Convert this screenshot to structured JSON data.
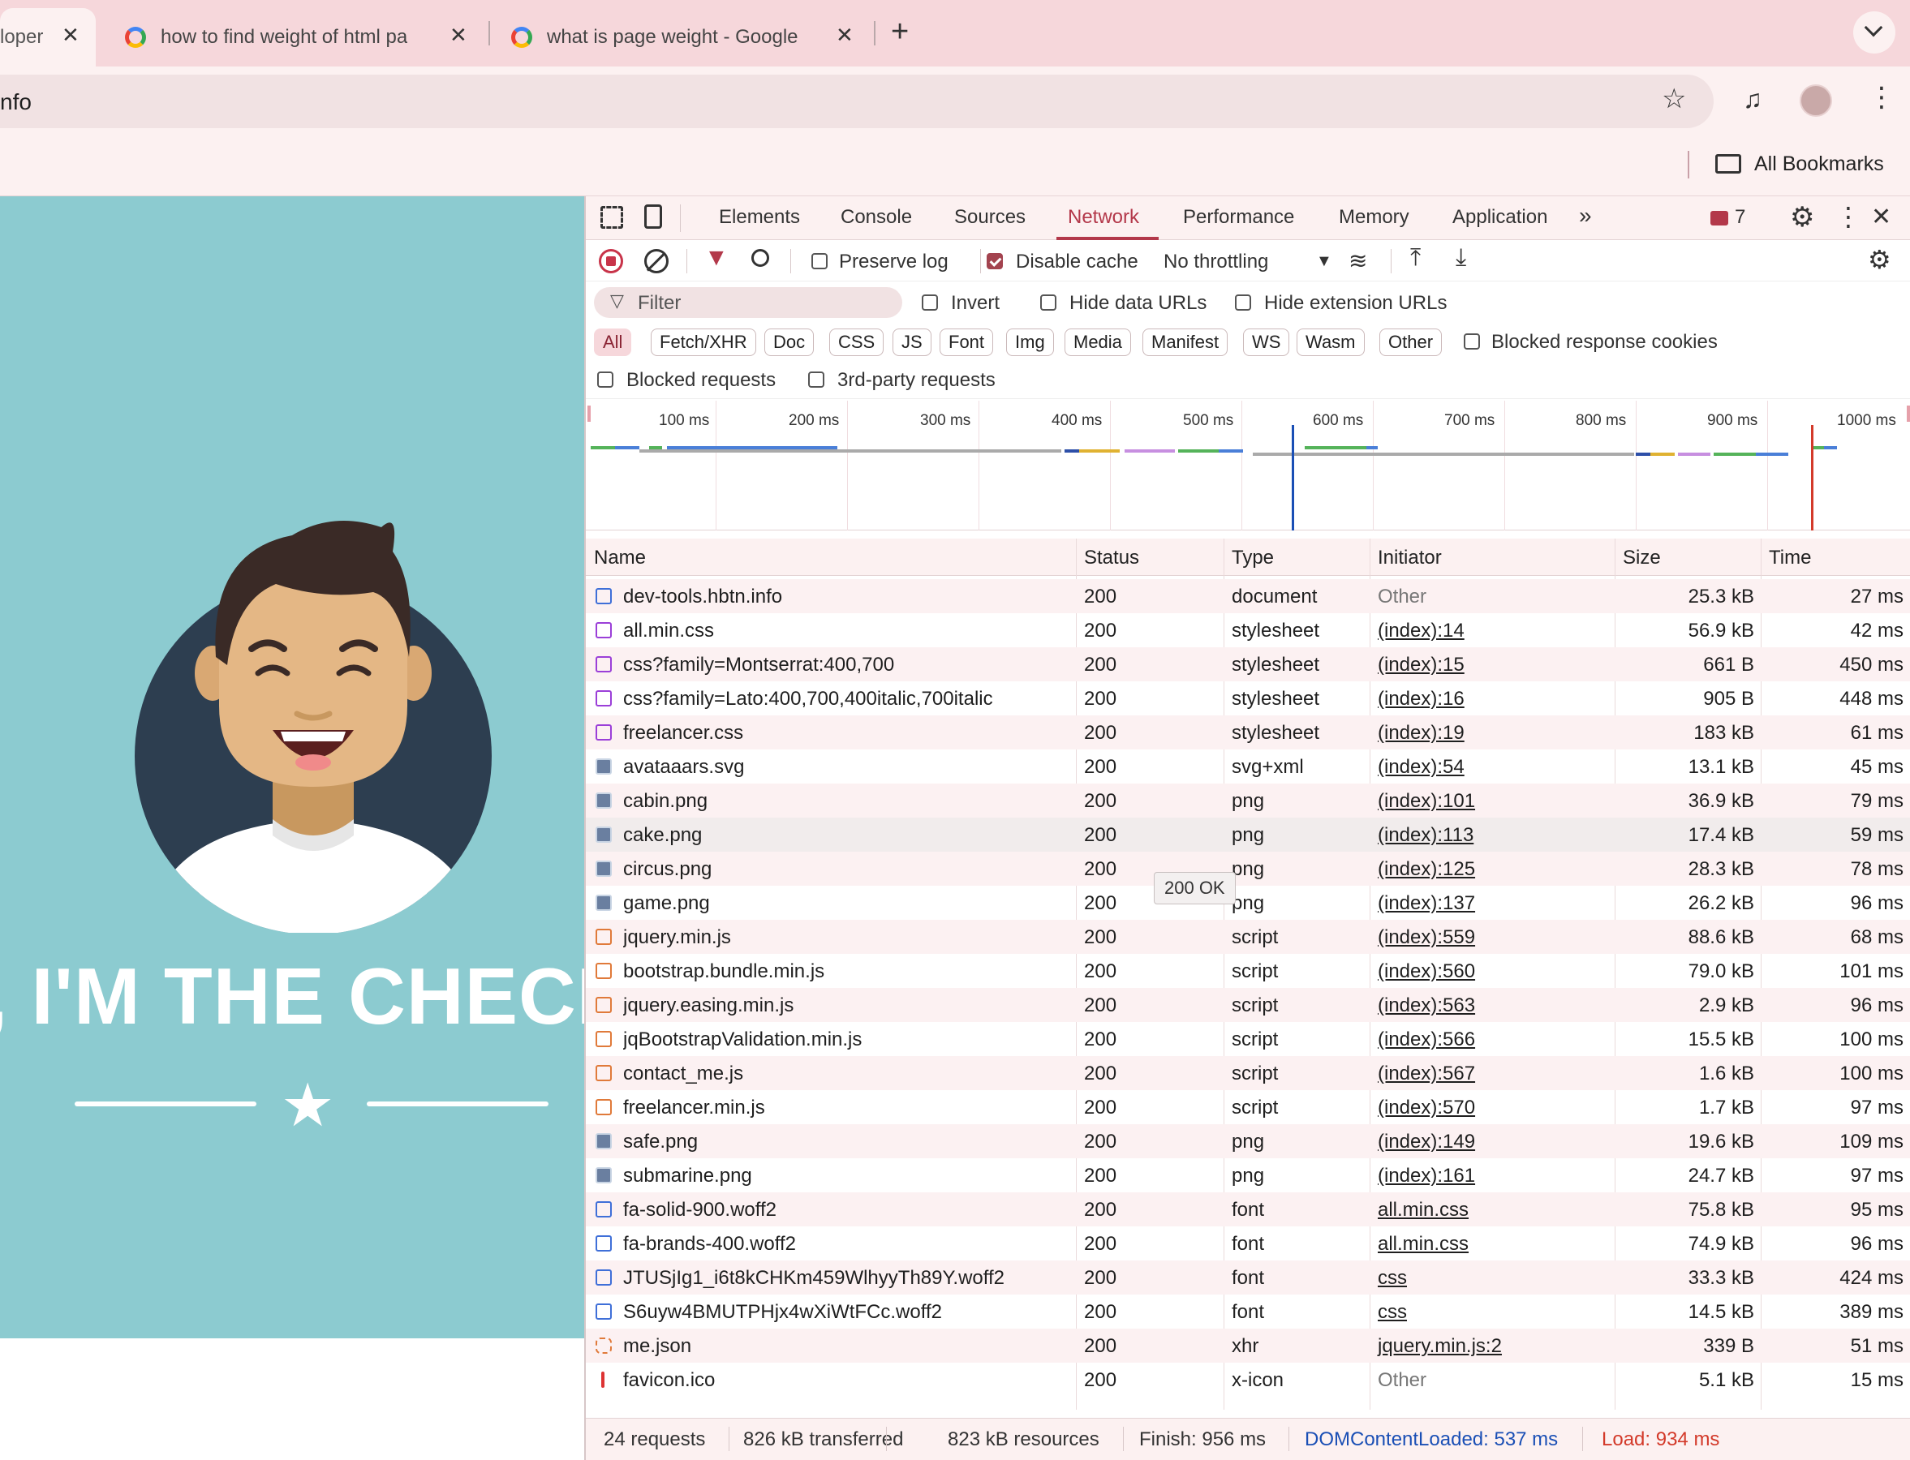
{
  "browser": {
    "tabs": [
      {
        "title": "loper",
        "active": true
      },
      {
        "title": "how to find weight of html pa",
        "active": false
      },
      {
        "title": "what is page weight - Google",
        "active": false
      }
    ],
    "new_tab_label": "+",
    "address": "nfo",
    "bookmarks_label": "All Bookmarks"
  },
  "page": {
    "hero_text": ", I'M THE CHECK"
  },
  "devtools": {
    "tabs": [
      "Elements",
      "Console",
      "Sources",
      "Network",
      "Performance",
      "Memory",
      "Application"
    ],
    "active_tab": "Network",
    "issues_count": "7",
    "toolbar": {
      "preserve_log": "Preserve log",
      "disable_cache": "Disable cache",
      "throttling": "No throttling"
    },
    "filter": {
      "placeholder": "Filter",
      "invert": "Invert",
      "hide_data_urls": "Hide data URLs",
      "hide_extension_urls": "Hide extension URLs"
    },
    "type_filters": [
      "All",
      "Fetch/XHR",
      "Doc",
      "CSS",
      "JS",
      "Font",
      "Img",
      "Media",
      "Manifest",
      "WS",
      "Wasm",
      "Other"
    ],
    "blocked_response_cookies": "Blocked response cookies",
    "blocked_requests": "Blocked requests",
    "third_party_requests": "3rd-party requests",
    "timeline_ticks": [
      "100 ms",
      "200 ms",
      "300 ms",
      "400 ms",
      "500 ms",
      "600 ms",
      "700 ms",
      "800 ms",
      "900 ms",
      "1000 ms"
    ],
    "columns": [
      "Name",
      "Status",
      "Type",
      "Initiator",
      "Size",
      "Time"
    ],
    "requests": [
      {
        "name": "dev-tools.hbtn.info",
        "status": "200",
        "type": "document",
        "initiator": "Other",
        "size": "25.3 kB",
        "time": "27 ms",
        "icon": "doc"
      },
      {
        "name": "all.min.css",
        "status": "200",
        "type": "stylesheet",
        "initiator": "(index):14",
        "size": "56.9 kB",
        "time": "42 ms",
        "icon": "css"
      },
      {
        "name": "css?family=Montserrat:400,700",
        "status": "200",
        "type": "stylesheet",
        "initiator": "(index):15",
        "size": "661 B",
        "time": "450 ms",
        "icon": "css"
      },
      {
        "name": "css?family=Lato:400,700,400italic,700italic",
        "status": "200",
        "type": "stylesheet",
        "initiator": "(index):16",
        "size": "905 B",
        "time": "448 ms",
        "icon": "css"
      },
      {
        "name": "freelancer.css",
        "status": "200",
        "type": "stylesheet",
        "initiator": "(index):19",
        "size": "183 kB",
        "time": "61 ms",
        "icon": "css"
      },
      {
        "name": "avataaars.svg",
        "status": "200",
        "type": "svg+xml",
        "initiator": "(index):54",
        "size": "13.1 kB",
        "time": "45 ms",
        "icon": "img"
      },
      {
        "name": "cabin.png",
        "status": "200",
        "type": "png",
        "initiator": "(index):101",
        "size": "36.9 kB",
        "time": "79 ms",
        "icon": "img"
      },
      {
        "name": "cake.png",
        "status": "200",
        "type": "png",
        "initiator": "(index):113",
        "size": "17.4 kB",
        "time": "59 ms",
        "icon": "img"
      },
      {
        "name": "circus.png",
        "status": "200",
        "type": "png",
        "initiator": "(index):125",
        "size": "28.3 kB",
        "time": "78 ms",
        "icon": "img"
      },
      {
        "name": "game.png",
        "status": "200",
        "type": "png",
        "initiator": "(index):137",
        "size": "26.2 kB",
        "time": "96 ms",
        "icon": "img"
      },
      {
        "name": "jquery.min.js",
        "status": "200",
        "type": "script",
        "initiator": "(index):559",
        "size": "88.6 kB",
        "time": "68 ms",
        "icon": "js"
      },
      {
        "name": "bootstrap.bundle.min.js",
        "status": "200",
        "type": "script",
        "initiator": "(index):560",
        "size": "79.0 kB",
        "time": "101 ms",
        "icon": "js"
      },
      {
        "name": "jquery.easing.min.js",
        "status": "200",
        "type": "script",
        "initiator": "(index):563",
        "size": "2.9 kB",
        "time": "96 ms",
        "icon": "js"
      },
      {
        "name": "jqBootstrapValidation.min.js",
        "status": "200",
        "type": "script",
        "initiator": "(index):566",
        "size": "15.5 kB",
        "time": "100 ms",
        "icon": "js"
      },
      {
        "name": "contact_me.js",
        "status": "200",
        "type": "script",
        "initiator": "(index):567",
        "size": "1.6 kB",
        "time": "100 ms",
        "icon": "js"
      },
      {
        "name": "freelancer.min.js",
        "status": "200",
        "type": "script",
        "initiator": "(index):570",
        "size": "1.7 kB",
        "time": "97 ms",
        "icon": "js"
      },
      {
        "name": "safe.png",
        "status": "200",
        "type": "png",
        "initiator": "(index):149",
        "size": "19.6 kB",
        "time": "109 ms",
        "icon": "img"
      },
      {
        "name": "submarine.png",
        "status": "200",
        "type": "png",
        "initiator": "(index):161",
        "size": "24.7 kB",
        "time": "97 ms",
        "icon": "img"
      },
      {
        "name": "fa-solid-900.woff2",
        "status": "200",
        "type": "font",
        "initiator": "all.min.css",
        "size": "75.8 kB",
        "time": "95 ms",
        "icon": "font"
      },
      {
        "name": "fa-brands-400.woff2",
        "status": "200",
        "type": "font",
        "initiator": "all.min.css",
        "size": "74.9 kB",
        "time": "96 ms",
        "icon": "font"
      },
      {
        "name": "JTUSjIg1_i6t8kCHKm459WlhyyTh89Y.woff2",
        "status": "200",
        "type": "font",
        "initiator": "css",
        "size": "33.3 kB",
        "time": "424 ms",
        "icon": "font"
      },
      {
        "name": "S6uyw4BMUTPHjx4wXiWtFCc.woff2",
        "status": "200",
        "type": "font",
        "initiator": "css",
        "size": "14.5 kB",
        "time": "389 ms",
        "icon": "font"
      },
      {
        "name": "me.json",
        "status": "200",
        "type": "xhr",
        "initiator": "jquery.min.js:2",
        "size": "339 B",
        "time": "51 ms",
        "icon": "xhr"
      },
      {
        "name": "favicon.ico",
        "status": "200",
        "type": "x-icon",
        "initiator": "Other",
        "size": "5.1 kB",
        "time": "15 ms",
        "icon": "ico"
      }
    ],
    "tooltip": "200 OK",
    "status_bar": {
      "requests": "24 requests",
      "transferred": "826 kB transferred",
      "resources": "823 kB resources",
      "finish": "Finish: 956 ms",
      "dom_content_loaded": "DOMContentLoaded: 537 ms",
      "load": "Load: 934 ms"
    },
    "colors": {
      "accent": "#b3384a",
      "dcl": "#1a4fb5",
      "load": "#d33a2a"
    }
  }
}
